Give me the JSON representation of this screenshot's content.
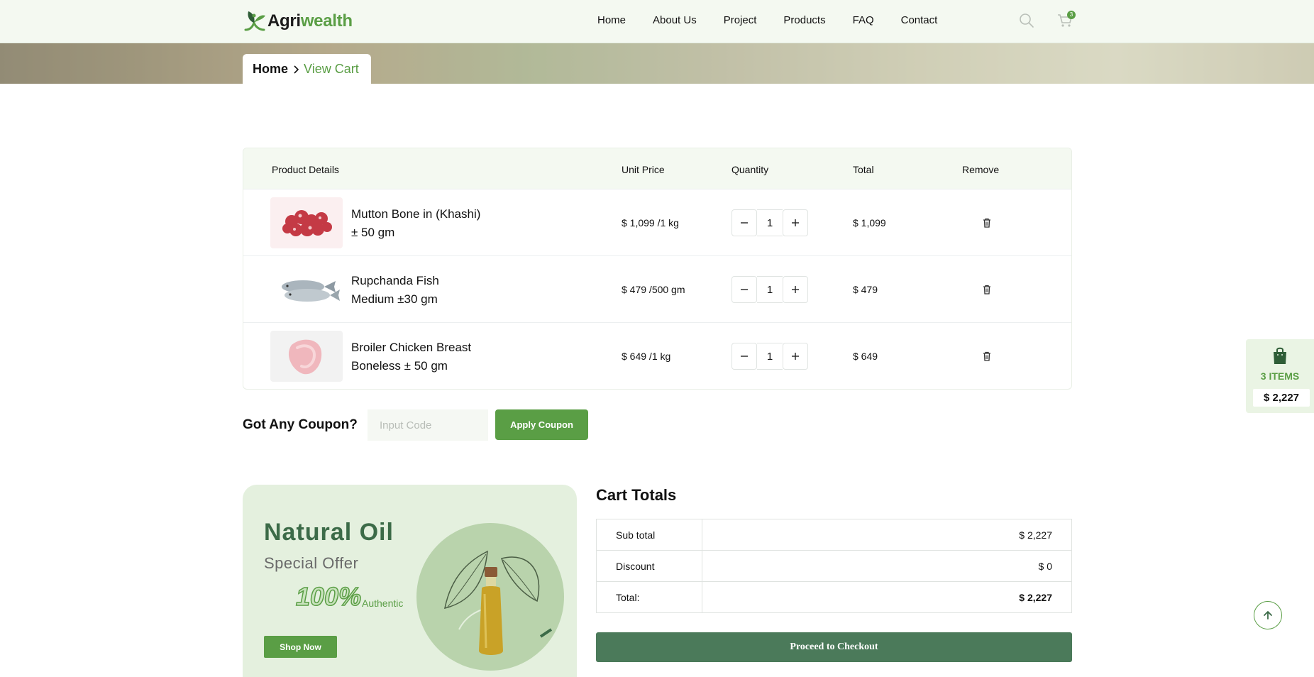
{
  "brand": {
    "name_part1": "Agri",
    "name_part2": "wealth"
  },
  "nav": {
    "items": [
      "Home",
      "About Us",
      "Project",
      "Products",
      "FAQ",
      "Contact"
    ]
  },
  "header": {
    "cart_count": "3"
  },
  "breadcrumb": {
    "home": "Home",
    "current": "View Cart"
  },
  "cart": {
    "columns": {
      "product": "Product Details",
      "unit_price": "Unit Price",
      "quantity": "Quantity",
      "total": "Total",
      "remove": "Remove"
    },
    "rows": [
      {
        "name_line1": "Mutton Bone in (Khashi)",
        "name_line2": "± 50 gm",
        "unit_price": "$ 1,099 /1 kg",
        "qty": "1",
        "total": "$ 1,099"
      },
      {
        "name_line1": "Rupchanda Fish",
        "name_line2": "Medium ±30 gm",
        "unit_price": "$ 479 /500 gm",
        "qty": "1",
        "total": "$ 479"
      },
      {
        "name_line1": "Broiler Chicken Breast",
        "name_line2": "Boneless ± 50 gm",
        "unit_price": "$ 649 /1 kg",
        "qty": "1",
        "total": "$ 649"
      }
    ]
  },
  "coupon": {
    "label": "Got Any Coupon?",
    "placeholder": "Input Code",
    "button": "Apply Coupon"
  },
  "promo": {
    "title": "Natural Oil",
    "subtitle": "Special Offer",
    "percent": "100%",
    "tag": "Authentic",
    "button": "Shop Now"
  },
  "totals": {
    "title": "Cart Totals",
    "subtotal_label": "Sub total",
    "subtotal": "$ 2,227",
    "discount_label": "Discount",
    "discount": "$ 0",
    "total_label": "Total:",
    "total": "$ 2,227",
    "checkout": "Proceed to Checkout"
  },
  "float_cart": {
    "items": "3 ITEMS",
    "amount": "$ 2,227"
  },
  "colors": {
    "brand_green": "#5a9e45",
    "checkout_green": "#4b7a5a",
    "promo_bg": "#e4f0de"
  }
}
